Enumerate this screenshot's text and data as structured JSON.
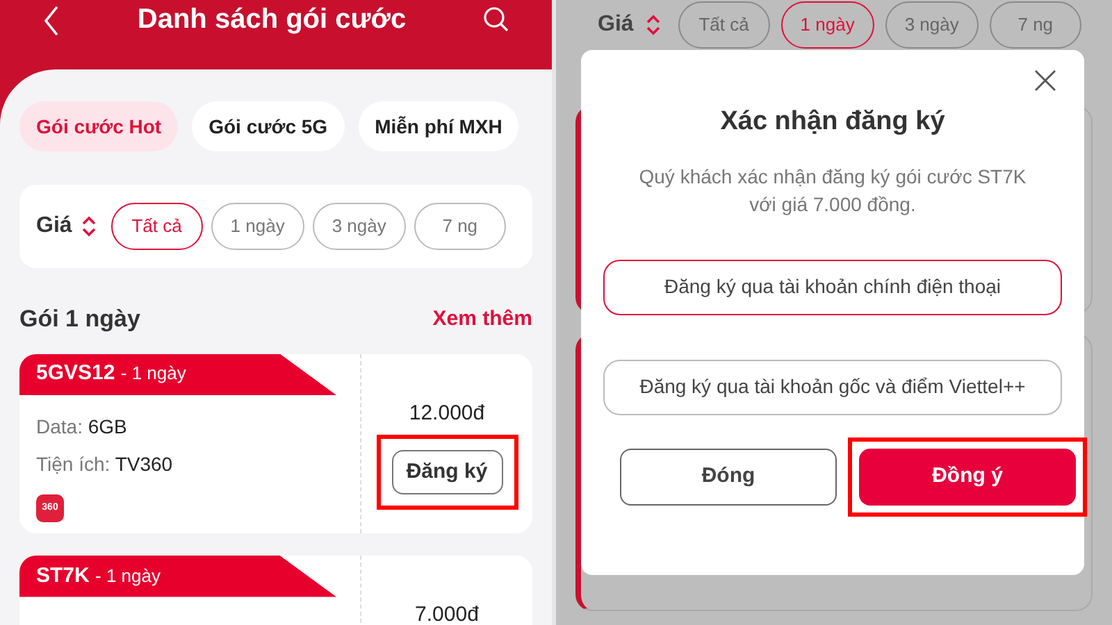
{
  "list_screen": {
    "header": {
      "title": "Danh sách gói cước"
    },
    "category_tabs": [
      {
        "label": "Gói cước Hot",
        "selected": true
      },
      {
        "label": "Gói cước 5G",
        "selected": false
      },
      {
        "label": "Miễn phí MXH",
        "selected": false
      }
    ],
    "price_filter": {
      "label": "Giá",
      "chips": [
        {
          "label": "Tất cả",
          "selected": true
        },
        {
          "label": "1 ngày",
          "selected": false
        },
        {
          "label": "3 ngày",
          "selected": false
        },
        {
          "label": "7 ng",
          "selected": false
        }
      ]
    },
    "section": {
      "title": "Gói 1 ngày",
      "link": "Xem thêm"
    },
    "packages": [
      {
        "code": "5GVS12",
        "duration": "- 1 ngày",
        "details": [
          {
            "label": "Data:",
            "value": "6GB"
          },
          {
            "label": "Tiện ích:",
            "value": "TV360"
          }
        ],
        "app_badge": "360",
        "price": "12.000đ",
        "button": "Đăng ký",
        "highlighted": true
      },
      {
        "code": "ST7K",
        "duration": "- 1 ngày",
        "price": "7.000đ"
      }
    ]
  },
  "confirm_screen": {
    "price_filter": {
      "label": "Giá",
      "chips": [
        {
          "label": "Tất cả",
          "selected": false
        },
        {
          "label": "1 ngày",
          "selected": true
        },
        {
          "label": "3 ngày",
          "selected": false
        },
        {
          "label": "7 ng",
          "selected": false
        }
      ]
    },
    "dialog": {
      "title": "Xác nhận đăng ký",
      "message": [
        "Quý khách xác nhận đăng ký gói cước ST7K",
        "với giá 7.000 đồng."
      ],
      "options": [
        {
          "label": "Đăng ký qua tài khoản chính điện thoại",
          "selected": true
        },
        {
          "label": "Đăng ký qua tài khoản gốc và điểm Viettel++",
          "selected": false
        }
      ],
      "buttons": [
        {
          "label": "Đóng",
          "kind": "secondary",
          "highlighted": false
        },
        {
          "label": "Đồng ý",
          "kind": "primary",
          "highlighted": true
        }
      ]
    }
  }
}
